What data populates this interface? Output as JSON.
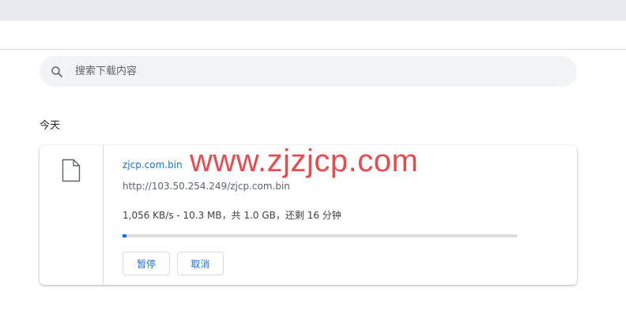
{
  "search": {
    "placeholder": "搜索下载内容"
  },
  "section": {
    "label": "今天"
  },
  "download": {
    "file_name": "zjcp.com.bin",
    "url": "http://103.50.254.249/zjcp.com.bin",
    "status": "1,056 KB/s - 10.3 MB，共 1.0 GB，还剩 16 分钟",
    "progress_fraction": 0.01,
    "pause_label": "暂停",
    "cancel_label": "取消"
  },
  "watermark": {
    "text": "www.zjzjcp.com",
    "color": "#e94a4f"
  },
  "colors": {
    "accent": "#1a73e8",
    "top_strip": "#e8eaed",
    "search_bg": "#f1f3f4"
  },
  "icons": {
    "search": "search-icon",
    "file": "file-icon"
  }
}
